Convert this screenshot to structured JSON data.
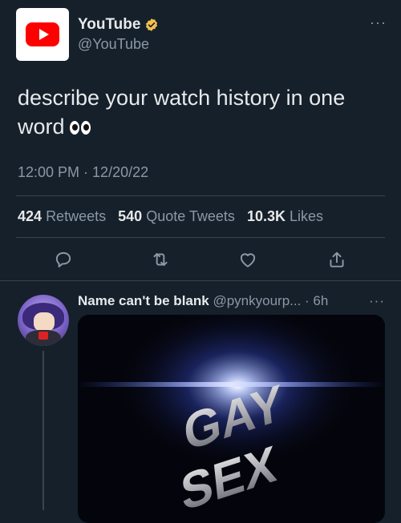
{
  "tweet": {
    "display_name": "YouTube",
    "handle": "@YouTube",
    "more": "···",
    "text": "describe your watch history in one word",
    "emoji": "eyes-emoji",
    "timestamp": "12:00 PM · 12/20/22",
    "stats": {
      "retweets_count": "424",
      "retweets_label": "Retweets",
      "quotes_count": "540",
      "quotes_label": "Quote Tweets",
      "likes_count": "10.3K",
      "likes_label": "Likes"
    },
    "actions": [
      "reply-icon",
      "retweet-icon",
      "like-icon",
      "share-icon"
    ]
  },
  "reply": {
    "display_name": "Name can't be blank",
    "handle_time": "@pynkyourp... · 6h",
    "more": "···",
    "media_text": [
      "GAY",
      "SEX"
    ]
  },
  "colors": {
    "background": "#15202b",
    "text": "#e7e9ea",
    "secondary": "#8b98a5",
    "divider": "#38444d",
    "verified": "#f4c04e",
    "youtube_red": "#ff0000"
  }
}
